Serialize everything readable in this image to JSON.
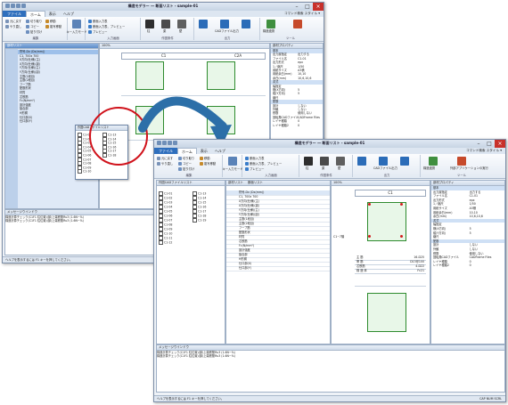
{
  "app_title": "構造モデラー ― 断面リスト - sample-01",
  "menu": {
    "file": "ファイル",
    "home": "ホーム",
    "view": "表示",
    "help": "ヘルプ",
    "right": "コマンド検索  スタイル ▾"
  },
  "ribbon": {
    "clipboard": {
      "undo": "元に戻す",
      "redo": "やり直し",
      "cut": "切り取り",
      "copy": "コピー",
      "paste": "貼り付け",
      "paste_spec": "形式を選択して",
      "label": "編集"
    },
    "move": {
      "move": "移動",
      "copy_move": "複写移動",
      "key_input": "キー入力モード"
    },
    "input": {
      "batch": "断面入力表",
      "list": "断面入力表、プレビュー",
      "preview": "プレビュー",
      "label": "入力画面"
    },
    "make": {
      "col": "柱",
      "beam": "梁",
      "wall": "壁",
      "label": "作図条件"
    },
    "output": {
      "out1": "出力",
      "cad": "CADファイル出力",
      "out2": "出図ブラウザ",
      "label": "出力"
    },
    "tools": {
      "a": "構造連携",
      "b": "外部アプリケーションの実行",
      "label": "ツール"
    }
  },
  "tabs": {
    "member_list": "部材リスト",
    "sec_list": "断面リスト",
    "tab3": "断面リスト",
    "zoom": "100%"
  },
  "left_tree": {
    "rows": [
      "全体",
      "Fc21",
      "柱形状",
      "柱",
      "2F",
      "1F"
    ],
    "header_rows": [
      "符号-Dx (Dx(mm))",
      "C1, 700x 700",
      "X方向(仕様)(主)",
      "X方向(仕様)(副)",
      "Y方向(仕様)(主)",
      "Y方向(仕様)(副)",
      "主筋(1段目)",
      "主筋(2段目)",
      "フープ筋",
      "配筋形状",
      "材質",
      "芯鉄筋",
      "Fc(N/mm²)",
      "設計強度",
      "接合部",
      "H形鋼",
      "仕口部(X)",
      "仕口部(Y)"
    ]
  },
  "cad_panel": {
    "title": "作図CADファイルリスト",
    "items": [
      "C1-01",
      "C1-02",
      "C1-03",
      "C1-04",
      "C1-05",
      "C1-06",
      "C1-07",
      "C1-08",
      "C1-09",
      "C1-10",
      "C1-11",
      "C1-12"
    ],
    "items2": [
      "C1-13",
      "C1-14",
      "C1-15",
      "C1-16",
      "C1-17",
      "C1-18",
      "C1-19"
    ]
  },
  "drawing": {
    "c1": "C1",
    "c2a": "C2A",
    "floor_label": "C1~7階",
    "dims": [
      "700",
      "700"
    ],
    "spec": [
      "主  筋",
      "帯  筋",
      "芯鉄筋",
      "構 造 体"
    ],
    "spec_vals": [
      "16-D25",
      "D13@100",
      "4-D22",
      "Fc21"
    ]
  },
  "props": {
    "title": "部材プロパティ",
    "rows": [
      "基本",
      "出力層指定",
      "ファイル名",
      "出力形式",
      "1／縮尺",
      "用紙サイズ",
      "用紙余白(mm)",
      "余白(mm)",
      "書式",
      "幅指定",
      "横(X方向)",
      "縦(Y方向)",
      "縮尺",
      "配筋",
      "設計",
      "外観",
      "鉄筋",
      "回転角CADファイル",
      "レイヤ種類",
      "レイヤ種類2"
    ],
    "vals": [
      "",
      "出力する",
      "C1-01",
      "epx",
      "1/50",
      "A3横",
      "10,10",
      "10,6,10,6",
      "",
      "",
      "5",
      "5",
      "",
      "",
      "しない",
      "しない",
      "使用しない",
      "CADFrame Files",
      "0",
      "0"
    ]
  },
  "messages": {
    "title": "メッセージウインドウ",
    "lines": [
      "構造計算チェック(C1F1 柱位置)(部)上端鉄筋Ru3 (1.6N~%)",
      "構造計算チェック(C1F1 柱位置)(部)上端鉄筋Ru3 (1.6N~%)"
    ]
  },
  "status": {
    "help": "ヘルプを表示するには F1 キーを押してください。",
    "right": "CAP  NUM  SCRL"
  },
  "colors": {
    "accent": "#2f6fbd",
    "arrow": "#2c6fa8",
    "highlight": "#d0121b",
    "column_fill": "#e8f7e8"
  }
}
